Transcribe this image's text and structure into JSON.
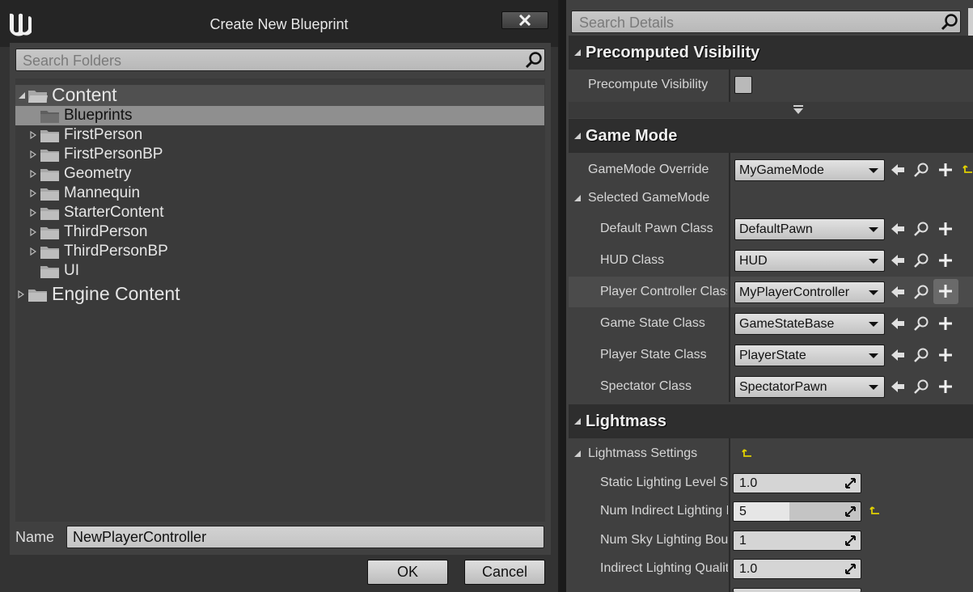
{
  "dialog": {
    "title": "Create New Blueprint",
    "search_placeholder": "Search Folders",
    "tree": {
      "root": "Content",
      "selected": "Blueprints",
      "children": [
        "Blueprints",
        "FirstPerson",
        "FirstPersonBP",
        "Geometry",
        "Mannequin",
        "StarterContent",
        "ThirdPerson",
        "ThirdPersonBP",
        "UI"
      ],
      "engine_root": "Engine Content"
    },
    "name_label": "Name",
    "name_value": "NewPlayerController",
    "ok_label": "OK",
    "cancel_label": "Cancel"
  },
  "details": {
    "search_placeholder": "Search Details",
    "precomputed_visibility": {
      "title": "Precomputed Visibility",
      "precompute_visibility_label": "Precompute Visibility",
      "precompute_visibility_checked": false
    },
    "game_mode": {
      "title": "Game Mode",
      "gamemode_override_label": "GameMode Override",
      "gamemode_override_value": "MyGameMode",
      "selected_gamemode_label": "Selected GameMode",
      "properties": [
        {
          "label": "Default Pawn Class",
          "value": "DefaultPawn"
        },
        {
          "label": "HUD Class",
          "value": "HUD"
        },
        {
          "label": "Player Controller Class",
          "value": "MyPlayerController"
        },
        {
          "label": "Game State Class",
          "value": "GameStateBase"
        },
        {
          "label": "Player State Class",
          "value": "PlayerState"
        },
        {
          "label": "Spectator Class",
          "value": "SpectatorPawn"
        }
      ]
    },
    "lightmass": {
      "title": "Lightmass",
      "settings_label": "Lightmass Settings",
      "properties": [
        {
          "label": "Static Lighting Level Scale",
          "value": "1.0"
        },
        {
          "label": "Num Indirect Lighting Bounces",
          "value": "5"
        },
        {
          "label": "Num Sky Lighting Bounces",
          "value": "1"
        },
        {
          "label": "Indirect Lighting Quality",
          "value": "1.0"
        }
      ]
    }
  },
  "colors": {
    "panel_bg": "#404040",
    "header_bg": "#2e2e2e",
    "selection": "#8f8f8f",
    "reset_arrow": "#e0d000"
  }
}
